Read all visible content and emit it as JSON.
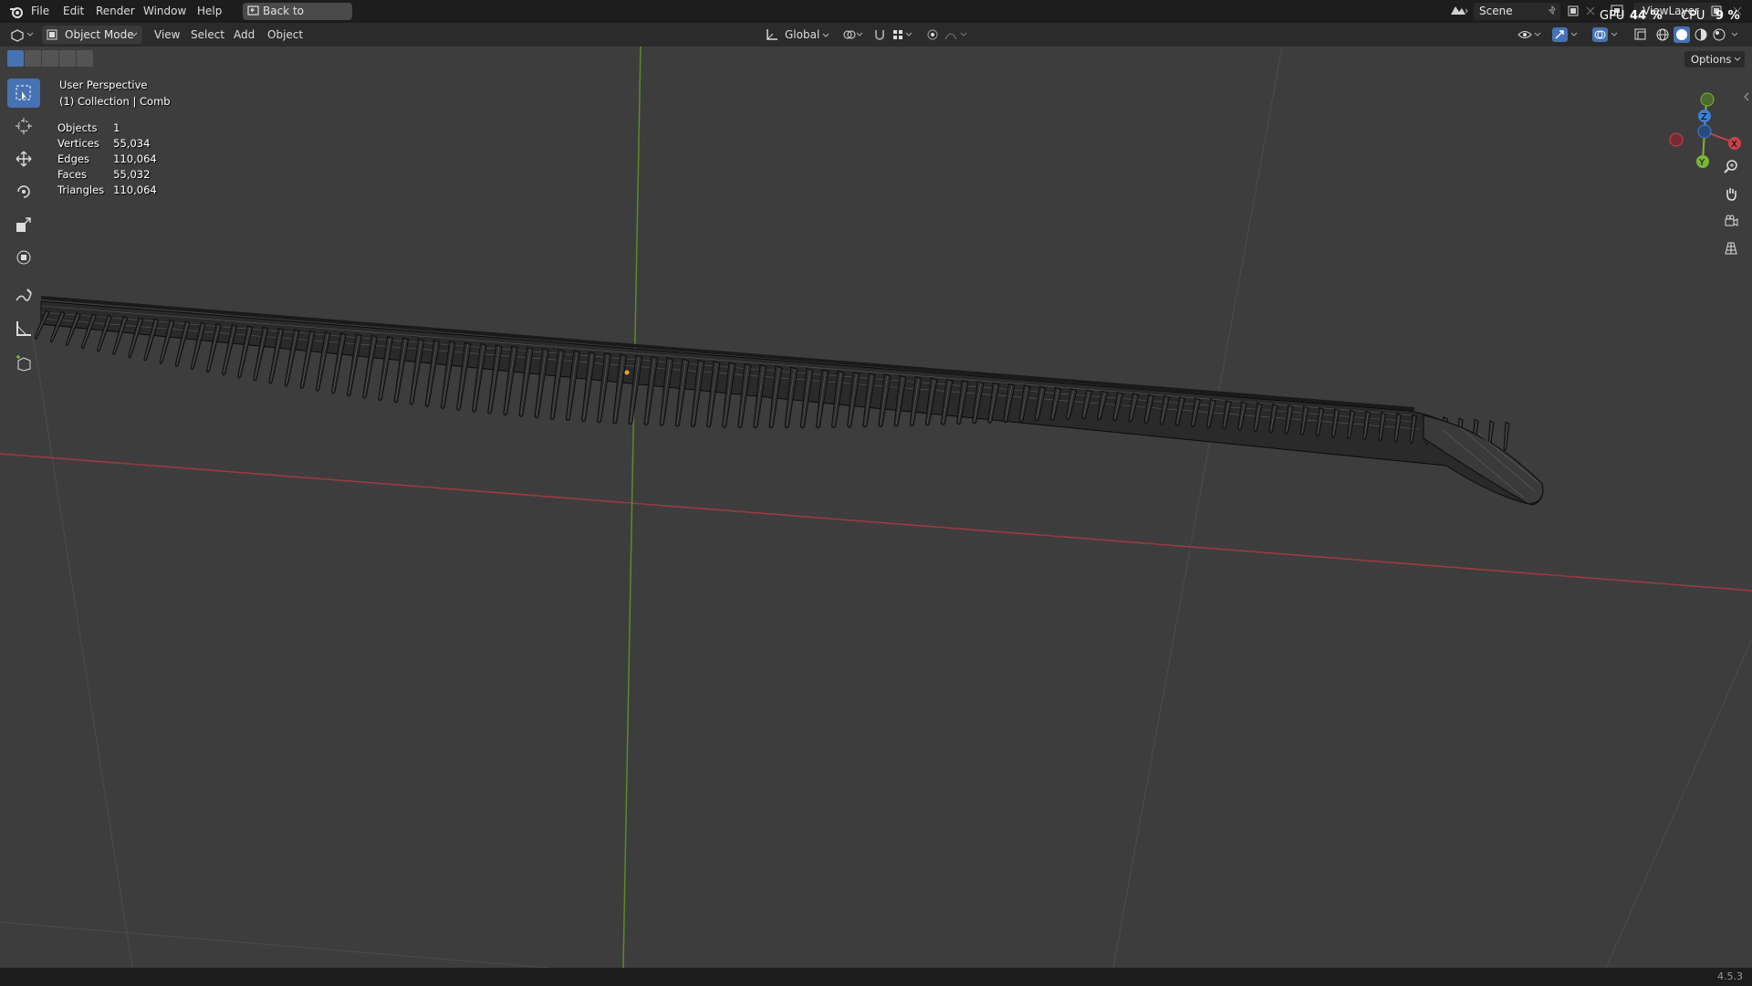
{
  "menu": {
    "items": [
      "File",
      "Edit",
      "Render",
      "Window",
      "Help"
    ],
    "back_label": "Back to Previous"
  },
  "scene": {
    "label": "Scene"
  },
  "viewlayer": {
    "label": "ViewLayer"
  },
  "perf": {
    "gpu_label": "GPU",
    "gpu_value": "44 %",
    "cpu_label": "CPU",
    "cpu_value": "9 %"
  },
  "header": {
    "mode": "Object Mode",
    "menus": [
      "View",
      "Select",
      "Add",
      "Object"
    ],
    "orientation": "Global",
    "options": "Options"
  },
  "overlay": {
    "view_name": "User Perspective",
    "collection": "(1) Collection | Comb",
    "stats": [
      {
        "label": "Objects",
        "value": "1"
      },
      {
        "label": "Vertices",
        "value": "55,034"
      },
      {
        "label": "Edges",
        "value": "110,064"
      },
      {
        "label": "Faces",
        "value": "55,032"
      },
      {
        "label": "Triangles",
        "value": "110,064"
      }
    ]
  },
  "gizmo": {
    "x_label": "X",
    "y_label": "Y",
    "z_label": "Z"
  },
  "status": {
    "version": "4.5.3"
  },
  "colors": {
    "x_axis": "#c8434c",
    "y_axis": "#7ab63a",
    "z_axis": "#3d7fd6",
    "active_tool": "#4772b3",
    "viewport_bg": "#3d3d3d"
  },
  "tools": [
    "select-box-tool",
    "cursor-tool",
    "move-tool",
    "rotate-tool",
    "scale-tool",
    "transform-tool",
    "annotate-tool",
    "measure-tool",
    "add-cube-tool"
  ]
}
